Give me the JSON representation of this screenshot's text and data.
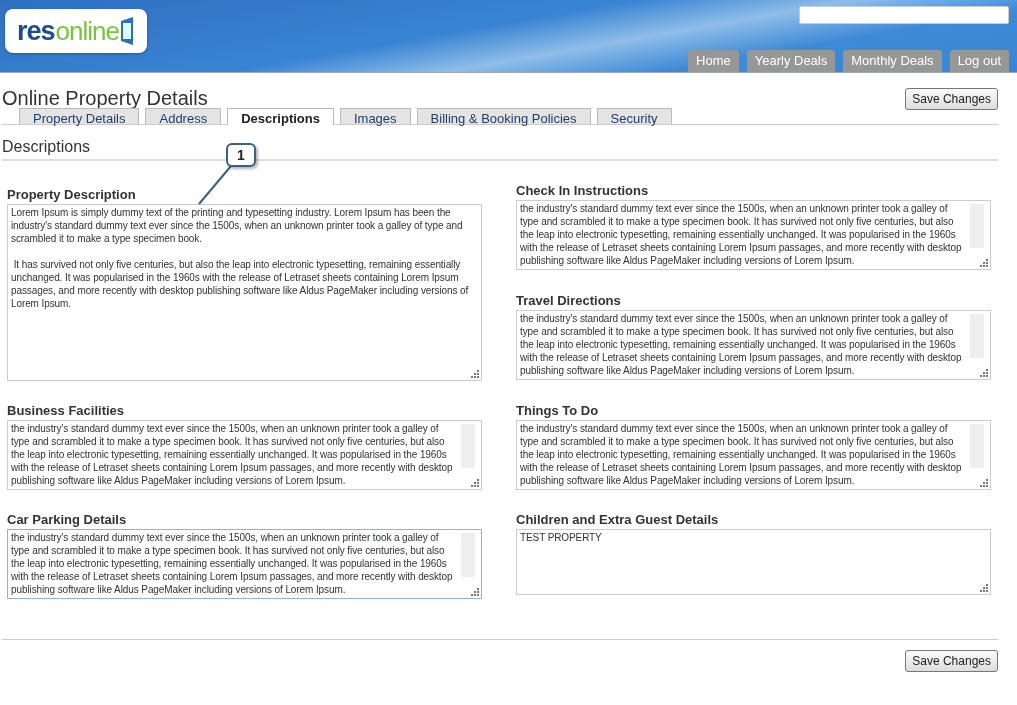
{
  "header": {
    "logo": {
      "part_1": "res",
      "part_2": "online"
    },
    "nav": [
      {
        "label": "Home"
      },
      {
        "label": "Yearly Deals"
      },
      {
        "label": "Monthly Deals"
      },
      {
        "label": "Log out"
      }
    ]
  },
  "page_title": "Online Property Details",
  "tabs": [
    {
      "label": "Property Details",
      "selected": false
    },
    {
      "label": "Address",
      "selected": false
    },
    {
      "label": "Descriptions",
      "selected": true
    },
    {
      "label": "Images",
      "selected": false
    },
    {
      "label": "Billing & Booking Policies",
      "selected": false
    },
    {
      "label": "Security",
      "selected": false
    }
  ],
  "save_button_top": "Save Changes",
  "section_title": "Descriptions",
  "callout": "1",
  "fields": [
    {
      "label": "Property Description",
      "kind": "tall",
      "focused": false,
      "value": "Lorem Ipsum is simply dummy text of the printing and typesetting industry. Lorem Ipsum has been the industry's standard dummy text ever since the 1500s, when an unknown printer took a galley of type and scrambled it to make a type specimen book.\n\n It has survived not only five centuries, but also the leap into electronic typesetting, remaining essentially unchanged. It was popularised in the 1960s with the release of Letraset sheets containing Lorem Ipsum passages, and more recently with desktop publishing software like Aldus PageMaker including versions of Lorem Ipsum."
    },
    {
      "label": "Check In Instructions",
      "kind": "scrolled",
      "focused": false,
      "value": "the industry's standard dummy text ever since the 1500s, when an unknown printer took a galley of type and scrambled it to make a type specimen book. It has survived not only five centuries, but also the leap into electronic typesetting, remaining essentially unchanged. It was popularised in the 1960s with the release of Letraset sheets containing Lorem Ipsum passages, and more recently with desktop publishing software like Aldus PageMaker including versions of Lorem Ipsum."
    },
    {
      "label": "Travel Directions",
      "kind": "scrolled",
      "focused": false,
      "value": "the industry's standard dummy text ever since the 1500s, when an unknown printer took a galley of type and scrambled it to make a type specimen book. It has survived not only five centuries, but also the leap into electronic typesetting, remaining essentially unchanged. It was popularised in the 1960s with the release of Letraset sheets containing Lorem Ipsum passages, and more recently with desktop publishing software like Aldus PageMaker including versions of Lorem Ipsum."
    },
    {
      "label": "Business Facilities",
      "kind": "scrolled",
      "focused": false,
      "value": "the industry's standard dummy text ever since the 1500s, when an unknown printer took a galley of type and scrambled it to make a type specimen book. It has survived not only five centuries, but also the leap into electronic typesetting, remaining essentially unchanged. It was popularised in the 1960s with the release of Letraset sheets containing Lorem Ipsum passages, and more recently with desktop publishing software like Aldus PageMaker including versions of Lorem Ipsum."
    },
    {
      "label": "Things To Do",
      "kind": "scrolled",
      "focused": false,
      "value": "the industry's standard dummy text ever since the 1500s, when an unknown printer took a galley of type and scrambled it to make a type specimen book. It has survived not only five centuries, but also the leap into electronic typesetting, remaining essentially unchanged. It was popularised in the 1960s with the release of Letraset sheets containing Lorem Ipsum passages, and more recently with desktop publishing software like Aldus PageMaker including versions of Lorem Ipsum."
    },
    {
      "label": "Car Parking Details",
      "kind": "scrolled",
      "focused": true,
      "value": "the industry's standard dummy text ever since the 1500s, when an unknown printer took a galley of type and scrambled it to make a type specimen book. It has survived not only five centuries, but also the leap into electronic typesetting, remaining essentially unchanged. It was popularised in the 1960s with the release of Letraset sheets containing Lorem Ipsum passages, and more recently with desktop publishing software like Aldus PageMaker including versions of Lorem Ipsum."
    },
    {
      "label": "Children and Extra Guest Details",
      "kind": "plain",
      "focused": false,
      "value": "TEST PROPERTY"
    }
  ],
  "save_button_bottom": "Save Changes"
}
